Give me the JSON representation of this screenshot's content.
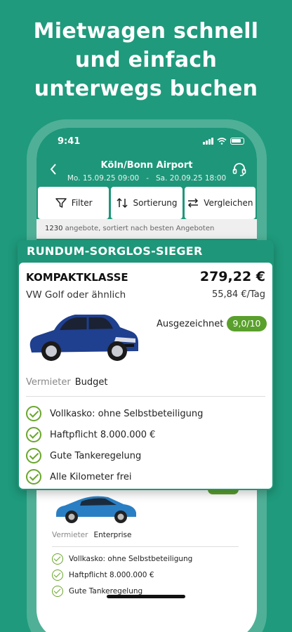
{
  "promo": {
    "line1": "Mietwagen schnell",
    "line2": "und einfach",
    "line3": "unterwegs buchen"
  },
  "status_bar": {
    "time": "9:41"
  },
  "header": {
    "location": "Köln/Bonn Airport",
    "dates": "Mo. 15.09.25 09:00   -   Sa. 20.09.25 18:00"
  },
  "toolbar": {
    "filter_label": "Filter",
    "sort_label": "Sortierung",
    "compare_label": "Vergleichen"
  },
  "results": {
    "count": "1230",
    "summary": "angebote, sortiert nach besten Angeboten"
  },
  "highlight": {
    "banner": "RUNDUM-SORGLOS-SIEGER",
    "car_class": "KOMPAKTKLASSE",
    "model": "VW Golf oder ähnlich",
    "price": "279,22 €",
    "price_per_day": "55,84 €/Tag",
    "rating_label": "Ausgezeichnet",
    "rating": "9,0/10",
    "vermieter_label": "Vermieter",
    "vermieter": "Budget",
    "car_color": "#1f3f8f",
    "features": [
      "Vollkasko: ohne Selbstbeteiligung",
      "Haftpflicht 8.000.000 €",
      "Gute Tankeregelung",
      "Alle Kilometer frei"
    ]
  },
  "second_offer": {
    "vermieter_label": "Vermieter",
    "vermieter": "Enterprise",
    "car_color": "#2a7fc4",
    "features": [
      "Vollkasko: ohne Selbstbeteiligung",
      "Haftpflicht 8.000.000 €",
      "Gute Tankeregelung"
    ]
  },
  "colors": {
    "brand_green": "#1e9679",
    "rating_green": "#5aa02c",
    "check_green": "#6aa62d"
  }
}
